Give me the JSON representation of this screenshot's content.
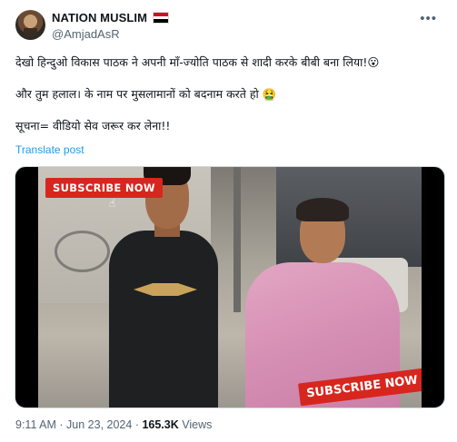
{
  "author": {
    "name": "NATION MUSLIM",
    "handle": "@AmjadAsR",
    "flag_colors": [
      "#ce1126",
      "#ffffff",
      "#000000"
    ]
  },
  "more_icon": "more-horizontal-icon",
  "post": {
    "line1": "देखो हिन्दुओ विकास पाठक ने अपनी माँ-ज्योति पाठक से शादी करके बीबी बना लिया!😮",
    "line2": "और तुम हलाल। के नाम पर मुसलामानों को बदनाम करते हो 🤮",
    "line3": "सूचना= वीडियो सेव जरूर कर लेना!!"
  },
  "translate_label": "Translate post",
  "media": {
    "badge_top": "SUBSCRIBE NOW",
    "badge_bottom": "SUBSCRIBE NOW",
    "badge_color": "#d7261e"
  },
  "meta": {
    "time": "9:11 AM",
    "sep1": " · ",
    "date": "Jun 23, 2024",
    "sep2": " · ",
    "views_count": "165.3K",
    "views_label": " Views"
  },
  "colors": {
    "link": "#1d9bf0",
    "muted": "#536471",
    "text": "#0f1419"
  }
}
